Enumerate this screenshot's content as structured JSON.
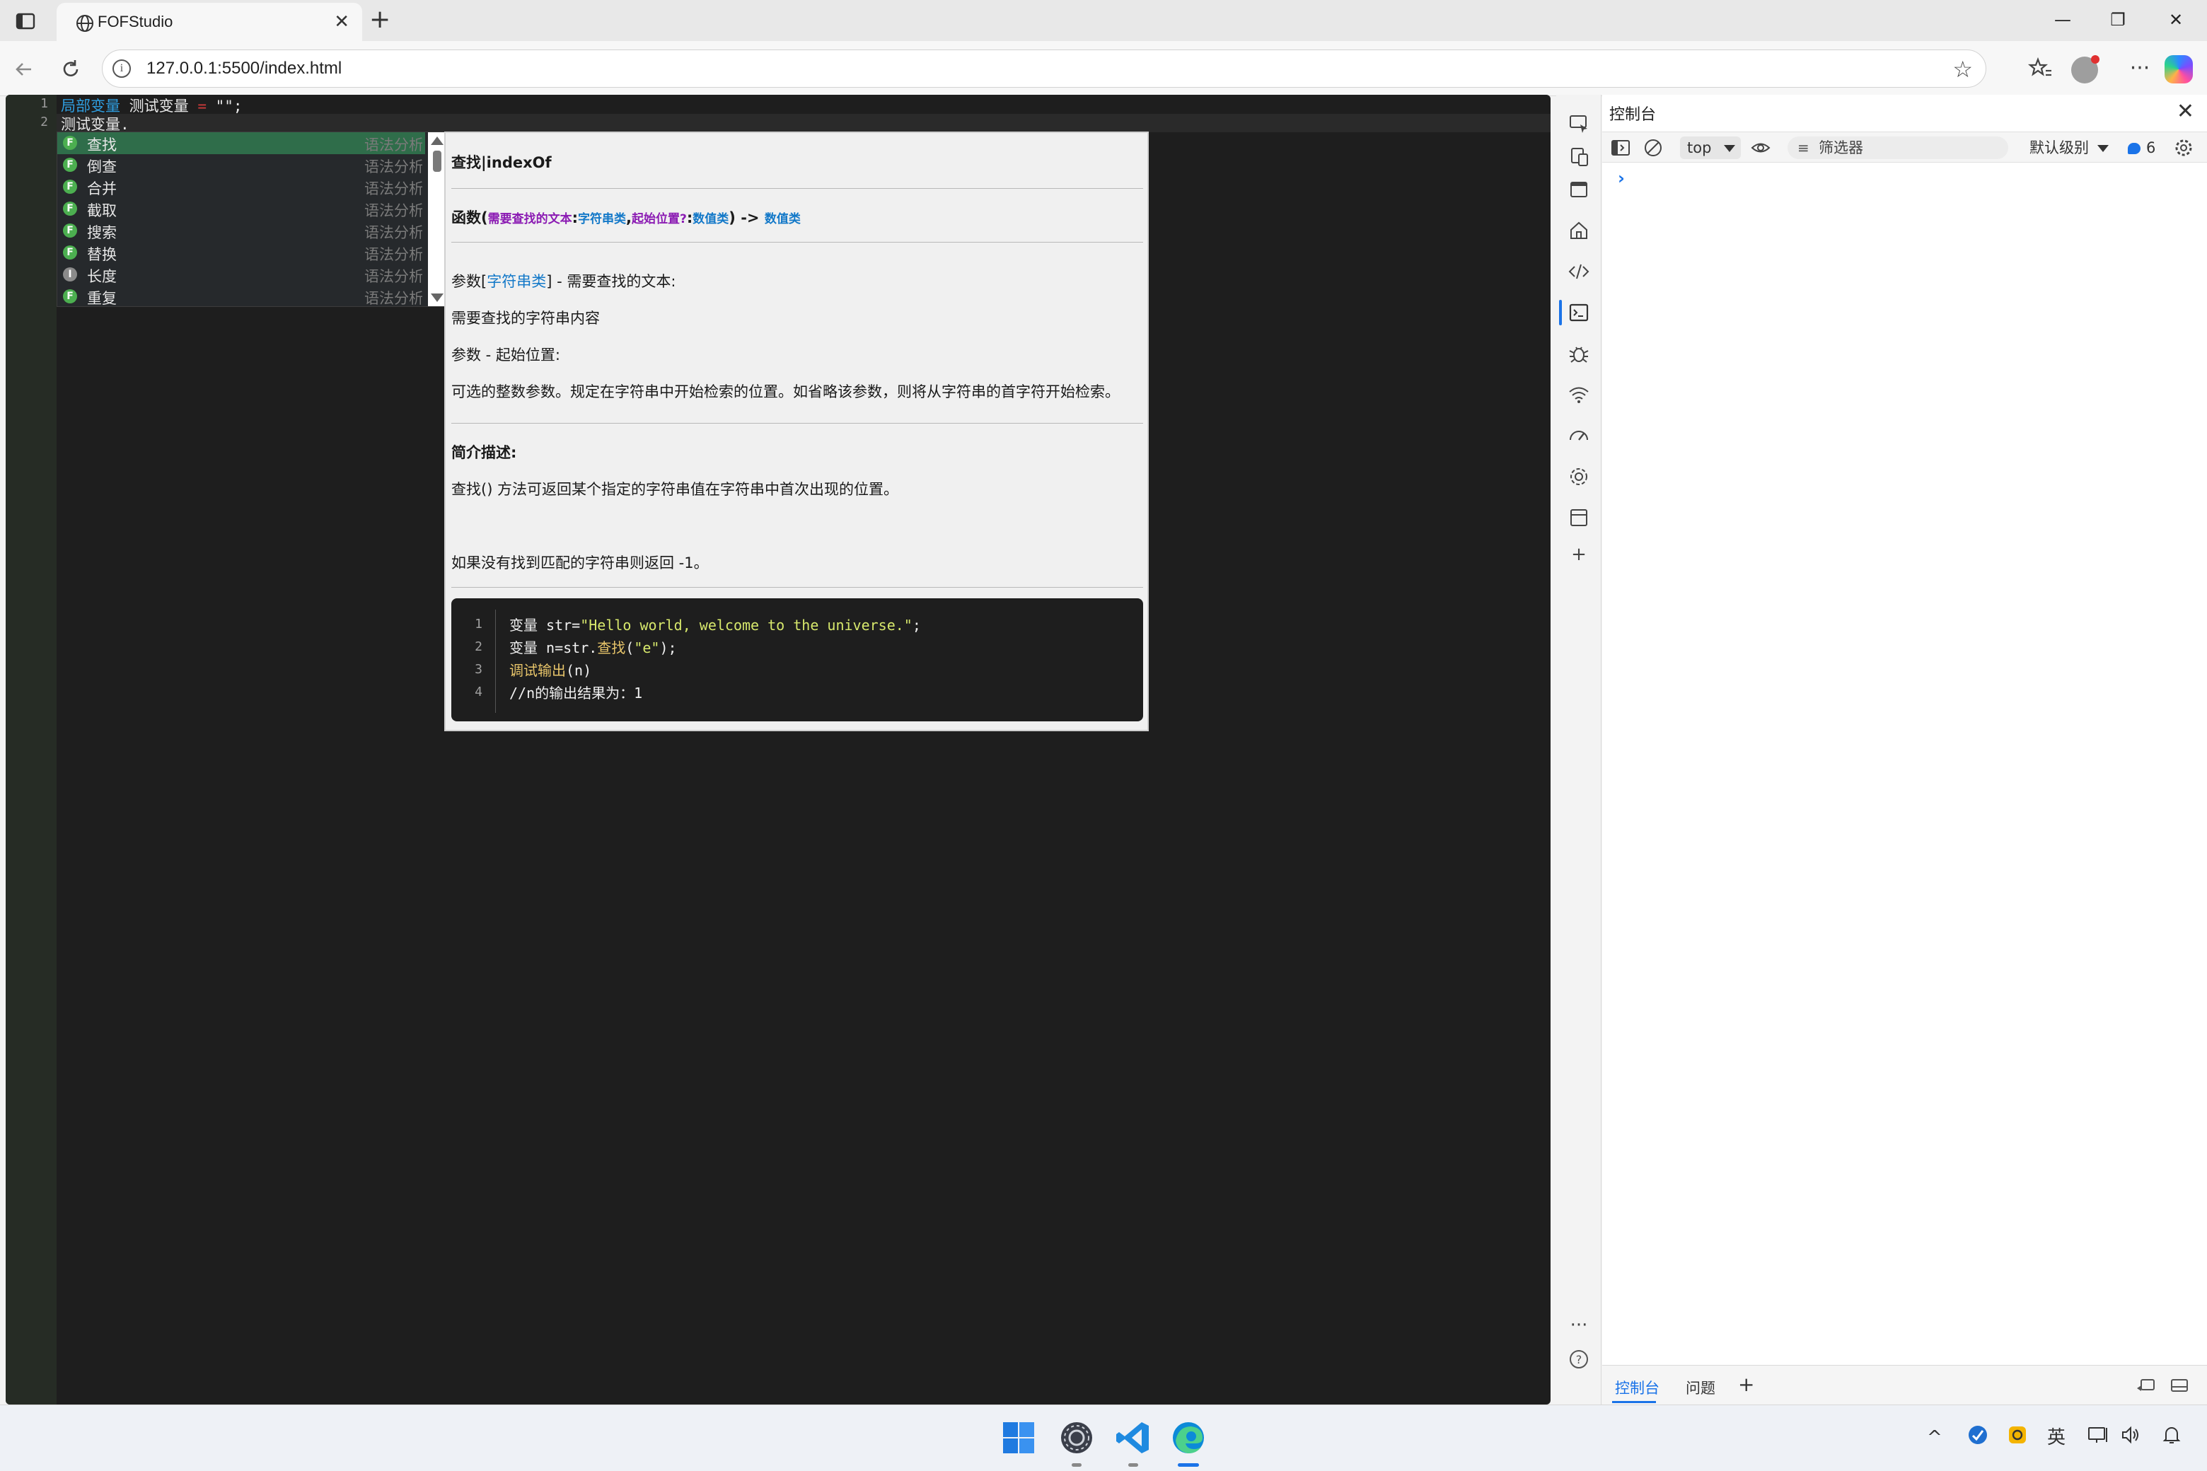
{
  "browser": {
    "tab_title": "FOFStudio",
    "tab_close": "✕",
    "new_tab": "+",
    "url": "127.0.0.1:5500/index.html",
    "window_controls": {
      "minimize": "—",
      "restore": "❐",
      "close": "✕"
    },
    "icons": [
      "sidebar-icon",
      "globe-icon",
      "back-icon",
      "refresh-icon",
      "info-icon",
      "star-icon",
      "favorites-icon",
      "more-icon"
    ]
  },
  "editor": {
    "line_numbers": [
      "1",
      "2"
    ],
    "line1": {
      "kw": "局部变量",
      "name": "测试变量",
      "op": "=",
      "rest": "\"\";"
    },
    "line2": "测试变量.",
    "autocomplete": [
      {
        "badge": "F",
        "label": "查找",
        "type": "语法分析"
      },
      {
        "badge": "F",
        "label": "倒查",
        "type": "语法分析"
      },
      {
        "badge": "F",
        "label": "合并",
        "type": "语法分析"
      },
      {
        "badge": "F",
        "label": "截取",
        "type": "语法分析"
      },
      {
        "badge": "F",
        "label": "搜索",
        "type": "语法分析"
      },
      {
        "badge": "F",
        "label": "替换",
        "type": "语法分析"
      },
      {
        "badge": "I",
        "label": "长度",
        "type": "语法分析"
      },
      {
        "badge": "F",
        "label": "重复",
        "type": "语法分析"
      }
    ],
    "doc": {
      "title": "查找|indexOf",
      "sig_prefix": "函数(",
      "sig_p1": "需要查找的文本",
      "sig_colon1": ":",
      "sig_t1": "字符串类",
      "sig_comma": ",",
      "sig_p2": "起始位置?",
      "sig_colon2": ":",
      "sig_t2": "数值类",
      "sig_close": ") ->",
      "sig_ret": "数值类",
      "param1_prefix": "参数[",
      "param1_type": "字符串类",
      "param1_suffix": "] - 需要查找的文本:",
      "param1_desc": "需要查找的字符串内容",
      "param2_label": "参数 - 起始位置:",
      "param2_desc": "可选的整数参数。规定在字符串中开始检索的位置。如省略该参数，则将从字符串的首字符开始检索。",
      "summary_heading": "简介描述:",
      "summary_text": "查找() 方法可返回某个指定的字符串值在字符串中首次出现的位置。",
      "note": "如果没有找到匹配的字符串则返回 -1。",
      "code_line_numbers": [
        "1",
        "2",
        "3",
        "4"
      ],
      "code": {
        "l1_a": "变量 str=",
        "l1_b": "\"Hello world, welcome to the universe.\"",
        "l1_c": ";",
        "l2_a": "变量 n=str.",
        "l2_b": "查找",
        "l2_c": "(",
        "l2_d": "\"e\"",
        "l2_e": ");",
        "l3_a": "调试输出",
        "l3_b": "(n)",
        "l4": "//n的输出结果为：1"
      }
    }
  },
  "devtools": {
    "title": "控制台",
    "close": "✕",
    "context": "top",
    "filter_placeholder": "筛选器",
    "level": "默认级别",
    "message_count": "6",
    "prompt": "›",
    "bottom_tabs": {
      "console": "控制台",
      "issues": "问题",
      "add": "+"
    },
    "rail_more": "···",
    "rail_help": "?"
  },
  "taskbar": {
    "tray_caret": "^",
    "ime": "英"
  },
  "colors": {
    "editor_bg": "#1e1e1e",
    "gutter_bg": "#262c25",
    "keyword": "#2f9ee0",
    "operator": "#d13b3b",
    "selected_row": "#2f6d4a",
    "badge": "#4caf50",
    "doc_purple": "#8b1bb3",
    "doc_blue": "#1278c8",
    "accent": "#1a73e8"
  }
}
